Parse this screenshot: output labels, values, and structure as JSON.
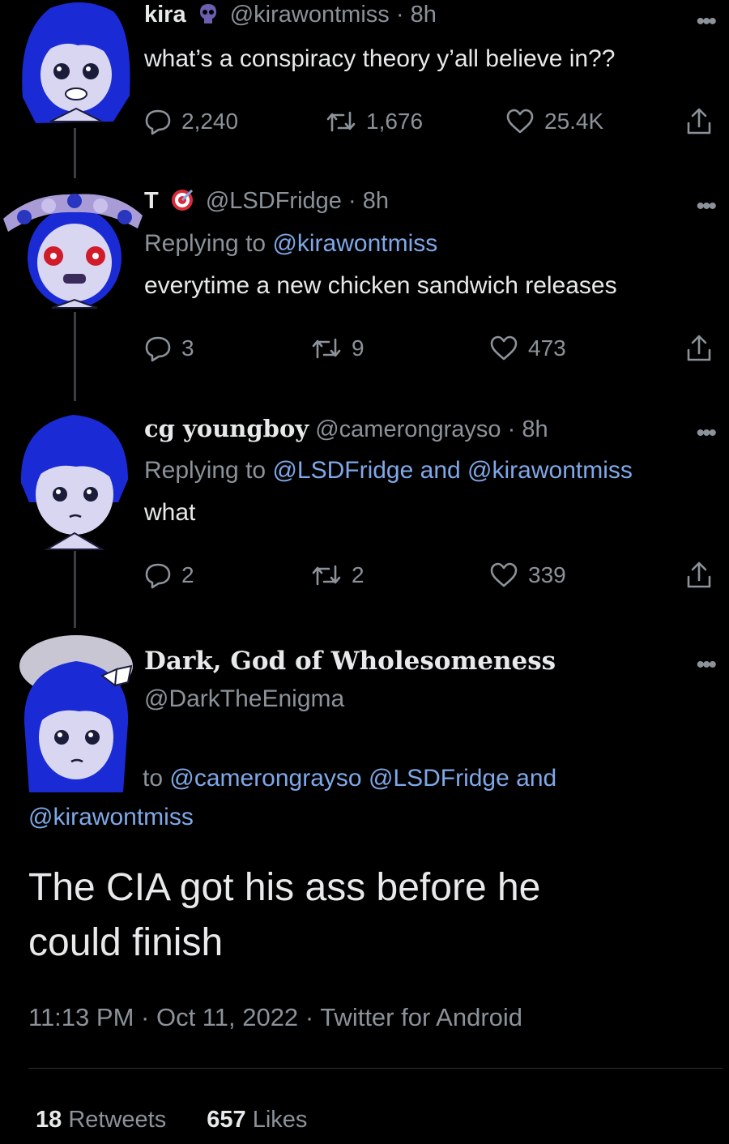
{
  "tweets": [
    {
      "display_name": "kira",
      "handle": "@kirawontmiss",
      "time": "8h",
      "text": "what’s a conspiracy theory y’all believe in??",
      "replies": "2,240",
      "retweets": "1,676",
      "likes": "25.4K"
    },
    {
      "display_name": "T",
      "handle": "@LSDFridge",
      "time": "8h",
      "replying_label": "Replying to",
      "replying_to": "@kirawontmiss",
      "text": "everytime a new chicken sandwich releases",
      "replies": "3",
      "retweets": "9",
      "likes": "473"
    },
    {
      "display_name": "cg youngboy",
      "handle": "@camerongrayso",
      "time": "8h",
      "replying_label": "Replying to",
      "replying_to_1": "@LSDFridge",
      "replying_and": "and",
      "replying_to_2": "@kirawontmiss",
      "text": "what",
      "replies": "2",
      "retweets": "2",
      "likes": "339"
    }
  ],
  "main_tweet": {
    "display_name": "Dark, God of Wholesomeness",
    "handle": "@DarkTheEnigma",
    "replying_label": "to",
    "replying_to_1": "@camerongrayso",
    "replying_to_2": "@LSDFridge",
    "replying_and": "and",
    "replying_to_3": "@kirawontmiss",
    "text_line1": "The CIA got his ass before he",
    "text_line2": "could finish",
    "time": "11:13 PM",
    "date": "Oct 11, 2022",
    "client": "Twitter for Android",
    "retweet_count": "18",
    "retweet_label": "Retweets",
    "like_count": "657",
    "like_label": "Likes"
  },
  "separator": "·",
  "more_glyph": "•••",
  "colors": {
    "background": "#000000",
    "text": "#e7e9ea",
    "muted": "#8b9299",
    "link": "#7fa8e8",
    "avatar_blue": "#1a2bd6",
    "avatar_skin": "#d9d6f2"
  },
  "icons": {
    "badge_kira": "alien-skull-icon",
    "badge_t": "target-icon",
    "reply": "reply-icon",
    "retweet": "retweet-icon",
    "like": "heart-icon",
    "share": "share-icon",
    "more": "more-icon"
  }
}
